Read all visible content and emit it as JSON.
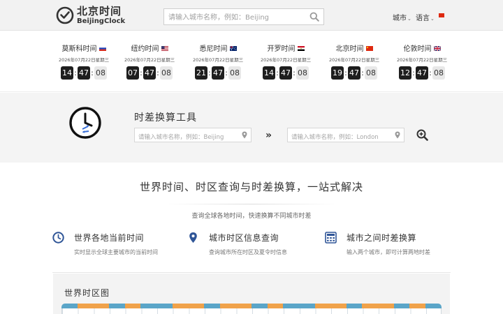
{
  "header": {
    "logo_title": "北京时间",
    "logo_subtitle": "BeijingClock",
    "search_placeholder": "请输入城市名称，例如：Beijing",
    "nav": [
      {
        "label": "城市"
      },
      {
        "label": "语言"
      }
    ],
    "flag_color": "#de2910"
  },
  "clocks": [
    {
      "city": "莫斯科时间",
      "flag": "russia-flag",
      "date": "2026年07月22日星期三",
      "hour": "14",
      "minute": "47",
      "second": "08"
    },
    {
      "city": "纽约时间",
      "flag": "usa-flag",
      "date": "2026年07月22日星期三",
      "hour": "07",
      "minute": "47",
      "second": "08"
    },
    {
      "city": "悉尼时间",
      "flag": "australia-flag",
      "date": "2026年07月22日星期三",
      "hour": "21",
      "minute": "47",
      "second": "08"
    },
    {
      "city": "开罗时间",
      "flag": "egypt-flag",
      "date": "2026年07月22日星期三",
      "hour": "14",
      "minute": "47",
      "second": "08"
    },
    {
      "city": "北京时间",
      "flag": "china-flag",
      "date": "2026年07月22日星期三",
      "hour": "19",
      "minute": "47",
      "second": "08"
    },
    {
      "city": "伦敦时间",
      "flag": "uk-flag",
      "date": "2026年07月22日星期三",
      "hour": "12",
      "minute": "47",
      "second": "08"
    }
  ],
  "converter": {
    "title": "时差换算工具",
    "from_placeholder": "请输入城市名称，例如：Beijing",
    "to_placeholder": "请输入城市名称，例如：London",
    "arrow": "»"
  },
  "section": {
    "title": "世界时间、时区查询与时差换算，一站式解决",
    "subtitle": "查询全球各地时间，快速换算不同城市时差"
  },
  "features": [
    {
      "icon": "clock-icon",
      "title": "世界各地当前时间",
      "desc": "实时显示全球主要城市的当前时间"
    },
    {
      "icon": "location-pin-icon",
      "title": "城市时区信息查询",
      "desc": "查询城市所在时区及夏令时信息"
    },
    {
      "icon": "calculator-icon",
      "title": "城市之间时差换算",
      "desc": "输入两个城市，即可计算两地时差"
    }
  ],
  "panel": {
    "title": "世界时区图"
  },
  "colors": {
    "ruler_orange": "#f0a24a",
    "ruler_blue": "#5aa5c8",
    "icon_blue": "#2f5597",
    "converter_arrow_blue": "#3a6fd8"
  }
}
